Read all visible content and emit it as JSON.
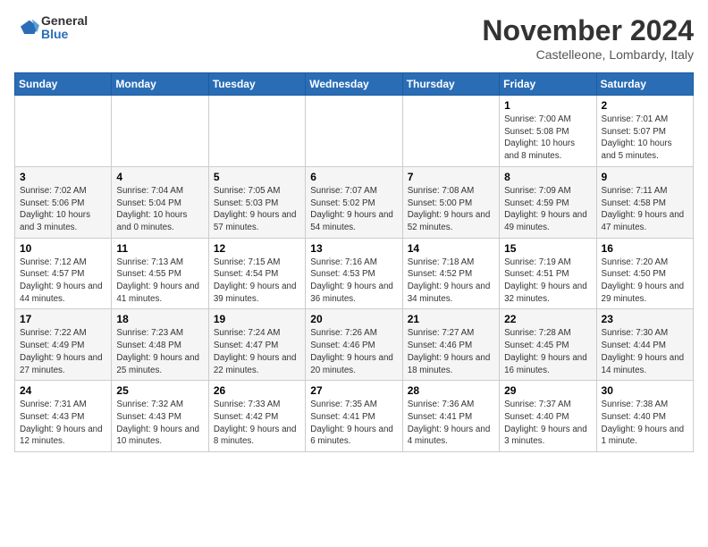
{
  "header": {
    "logo_general": "General",
    "logo_blue": "Blue",
    "month": "November 2024",
    "location": "Castelleone, Lombardy, Italy"
  },
  "weekdays": [
    "Sunday",
    "Monday",
    "Tuesday",
    "Wednesday",
    "Thursday",
    "Friday",
    "Saturday"
  ],
  "weeks": [
    [
      {
        "day": "",
        "info": ""
      },
      {
        "day": "",
        "info": ""
      },
      {
        "day": "",
        "info": ""
      },
      {
        "day": "",
        "info": ""
      },
      {
        "day": "",
        "info": ""
      },
      {
        "day": "1",
        "info": "Sunrise: 7:00 AM\nSunset: 5:08 PM\nDaylight: 10 hours\nand 8 minutes."
      },
      {
        "day": "2",
        "info": "Sunrise: 7:01 AM\nSunset: 5:07 PM\nDaylight: 10 hours\nand 5 minutes."
      }
    ],
    [
      {
        "day": "3",
        "info": "Sunrise: 7:02 AM\nSunset: 5:06 PM\nDaylight: 10 hours\nand 3 minutes."
      },
      {
        "day": "4",
        "info": "Sunrise: 7:04 AM\nSunset: 5:04 PM\nDaylight: 10 hours\nand 0 minutes."
      },
      {
        "day": "5",
        "info": "Sunrise: 7:05 AM\nSunset: 5:03 PM\nDaylight: 9 hours\nand 57 minutes."
      },
      {
        "day": "6",
        "info": "Sunrise: 7:07 AM\nSunset: 5:02 PM\nDaylight: 9 hours\nand 54 minutes."
      },
      {
        "day": "7",
        "info": "Sunrise: 7:08 AM\nSunset: 5:00 PM\nDaylight: 9 hours\nand 52 minutes."
      },
      {
        "day": "8",
        "info": "Sunrise: 7:09 AM\nSunset: 4:59 PM\nDaylight: 9 hours\nand 49 minutes."
      },
      {
        "day": "9",
        "info": "Sunrise: 7:11 AM\nSunset: 4:58 PM\nDaylight: 9 hours\nand 47 minutes."
      }
    ],
    [
      {
        "day": "10",
        "info": "Sunrise: 7:12 AM\nSunset: 4:57 PM\nDaylight: 9 hours\nand 44 minutes."
      },
      {
        "day": "11",
        "info": "Sunrise: 7:13 AM\nSunset: 4:55 PM\nDaylight: 9 hours\nand 41 minutes."
      },
      {
        "day": "12",
        "info": "Sunrise: 7:15 AM\nSunset: 4:54 PM\nDaylight: 9 hours\nand 39 minutes."
      },
      {
        "day": "13",
        "info": "Sunrise: 7:16 AM\nSunset: 4:53 PM\nDaylight: 9 hours\nand 36 minutes."
      },
      {
        "day": "14",
        "info": "Sunrise: 7:18 AM\nSunset: 4:52 PM\nDaylight: 9 hours\nand 34 minutes."
      },
      {
        "day": "15",
        "info": "Sunrise: 7:19 AM\nSunset: 4:51 PM\nDaylight: 9 hours\nand 32 minutes."
      },
      {
        "day": "16",
        "info": "Sunrise: 7:20 AM\nSunset: 4:50 PM\nDaylight: 9 hours\nand 29 minutes."
      }
    ],
    [
      {
        "day": "17",
        "info": "Sunrise: 7:22 AM\nSunset: 4:49 PM\nDaylight: 9 hours\nand 27 minutes."
      },
      {
        "day": "18",
        "info": "Sunrise: 7:23 AM\nSunset: 4:48 PM\nDaylight: 9 hours\nand 25 minutes."
      },
      {
        "day": "19",
        "info": "Sunrise: 7:24 AM\nSunset: 4:47 PM\nDaylight: 9 hours\nand 22 minutes."
      },
      {
        "day": "20",
        "info": "Sunrise: 7:26 AM\nSunset: 4:46 PM\nDaylight: 9 hours\nand 20 minutes."
      },
      {
        "day": "21",
        "info": "Sunrise: 7:27 AM\nSunset: 4:46 PM\nDaylight: 9 hours\nand 18 minutes."
      },
      {
        "day": "22",
        "info": "Sunrise: 7:28 AM\nSunset: 4:45 PM\nDaylight: 9 hours\nand 16 minutes."
      },
      {
        "day": "23",
        "info": "Sunrise: 7:30 AM\nSunset: 4:44 PM\nDaylight: 9 hours\nand 14 minutes."
      }
    ],
    [
      {
        "day": "24",
        "info": "Sunrise: 7:31 AM\nSunset: 4:43 PM\nDaylight: 9 hours\nand 12 minutes."
      },
      {
        "day": "25",
        "info": "Sunrise: 7:32 AM\nSunset: 4:43 PM\nDaylight: 9 hours\nand 10 minutes."
      },
      {
        "day": "26",
        "info": "Sunrise: 7:33 AM\nSunset: 4:42 PM\nDaylight: 9 hours\nand 8 minutes."
      },
      {
        "day": "27",
        "info": "Sunrise: 7:35 AM\nSunset: 4:41 PM\nDaylight: 9 hours\nand 6 minutes."
      },
      {
        "day": "28",
        "info": "Sunrise: 7:36 AM\nSunset: 4:41 PM\nDaylight: 9 hours\nand 4 minutes."
      },
      {
        "day": "29",
        "info": "Sunrise: 7:37 AM\nSunset: 4:40 PM\nDaylight: 9 hours\nand 3 minutes."
      },
      {
        "day": "30",
        "info": "Sunrise: 7:38 AM\nSunset: 4:40 PM\nDaylight: 9 hours\nand 1 minute."
      }
    ]
  ]
}
